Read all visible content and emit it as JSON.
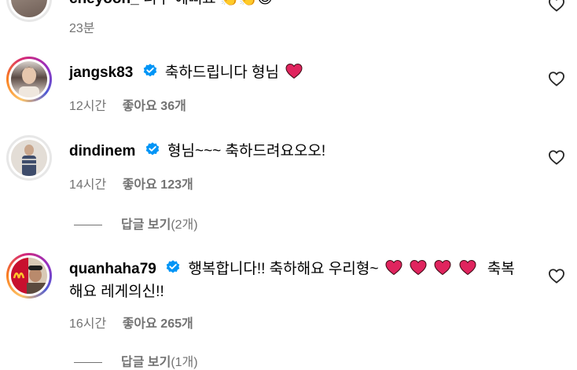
{
  "comments": [
    {
      "username": "cheyoon_",
      "text": "너무 예뻐요",
      "emojis": "👏👏😍",
      "time": "23분",
      "likes": ""
    },
    {
      "username": "jangsk83",
      "text": "축하드립니다 형님",
      "time": "12시간",
      "likes": "좋아요 36개",
      "verified": true
    },
    {
      "username": "dindinem",
      "text": "형님~~~ 축하드려요오오!",
      "time": "14시간",
      "likes": "좋아요 123개",
      "verified": true
    },
    {
      "username": "quanhaha79",
      "text_before": "행복합니다!! 축하해요 우리형~",
      "text_after": "축복",
      "text_line2": "해요 레게의신!!",
      "time": "16시간",
      "likes": "좋아요 265개",
      "verified": true
    }
  ],
  "replies_toggle": {
    "label": "답글 보기",
    "count": "(2개)"
  },
  "replies_toggle_partial": {
    "label": "답글 보기",
    "count": "(1개)"
  },
  "colors": {
    "heart": "#e0245e",
    "verified": "#0095f6",
    "meta_text": "#737373"
  }
}
